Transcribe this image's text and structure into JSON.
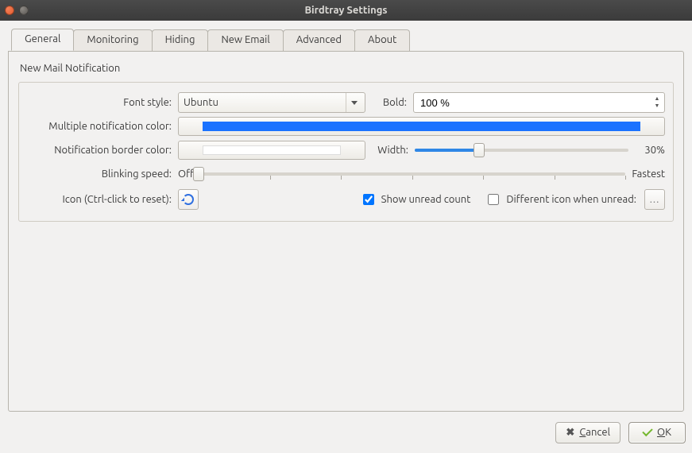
{
  "window": {
    "title": "Birdtray Settings"
  },
  "tabs": [
    {
      "label": "General"
    },
    {
      "label": "Monitoring"
    },
    {
      "label": "Hiding"
    },
    {
      "label": "New Email"
    },
    {
      "label": "Advanced"
    },
    {
      "label": "About"
    }
  ],
  "section": {
    "title": "New Mail Notification"
  },
  "labels": {
    "font_style": "Font style:",
    "bold": "Bold:",
    "multi_color": "Multiple notification color:",
    "border_color": "Notification border color:",
    "width": "Width:",
    "blink": "Blinking speed:",
    "icon": "Icon (Ctrl-click to reset):",
    "off": "Off",
    "fastest": "Fastest"
  },
  "values": {
    "font_style": "Ubuntu",
    "bold": "100 %",
    "multi_color": "#1a73ff",
    "border_color": "#ffffff",
    "width_percent": "30%",
    "width_slider_pct": 30,
    "blink_slider_pct": 0
  },
  "checks": {
    "show_unread": {
      "label": "Show unread count",
      "checked": true
    },
    "diff_icon": {
      "label": "Different icon when unread:",
      "checked": false
    }
  },
  "buttons": {
    "cancel": "Cancel",
    "ok": "OK"
  }
}
